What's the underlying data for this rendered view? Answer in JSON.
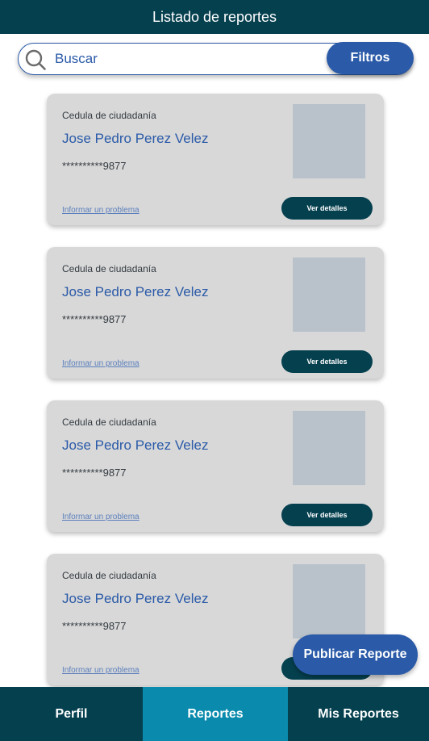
{
  "header": {
    "title": "Listado de reportes"
  },
  "search": {
    "placeholder": "Buscar",
    "icon": "search-icon",
    "filter_label": "Filtros"
  },
  "cards": [
    {
      "doc_type": "Cedula de ciudadanía",
      "name": "Jose Pedro Perez Velez",
      "doc_number": "**********9877",
      "report_link": "Informar un problema",
      "details_label": "Ver detalles"
    },
    {
      "doc_type": "Cedula de ciudadanía",
      "name": "Jose Pedro Perez Velez",
      "doc_number": "**********9877",
      "report_link": "Informar un problema",
      "details_label": "Ver detalles"
    },
    {
      "doc_type": "Cedula de ciudadanía",
      "name": "Jose Pedro Perez Velez",
      "doc_number": "**********9877",
      "report_link": "Informar un problema",
      "details_label": "Ver detalles"
    },
    {
      "doc_type": "Cedula de ciudadanía",
      "name": "Jose Pedro Perez Velez",
      "doc_number": "**********9877",
      "report_link": "Informar un problema",
      "details_label": "Ver detalles"
    }
  ],
  "fab": {
    "label": "Publicar Reporte"
  },
  "bottom_nav": {
    "active": "Reportes",
    "tabs": [
      {
        "label": "Perfil"
      },
      {
        "label": "Reportes"
      },
      {
        "label": "Mis Reportes"
      }
    ]
  },
  "colors": {
    "header_bg": "#05404f",
    "accent_blue": "#2a5aa8",
    "active_tab": "#0a8aac",
    "card_bg": "#d8d8d8",
    "photo_placeholder": "#b9c2cb"
  }
}
